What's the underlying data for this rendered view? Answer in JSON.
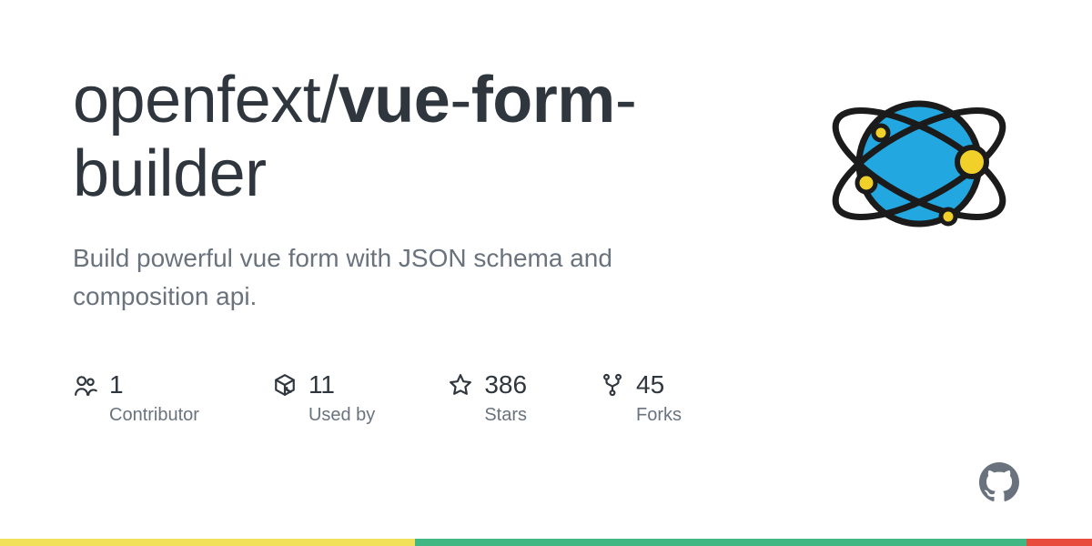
{
  "repo": {
    "owner": "openfext",
    "slash": "/",
    "name_part1": "vue",
    "dash1": "-",
    "name_part2": "form",
    "dash2": "-",
    "name_part3": "builder"
  },
  "description": "Build powerful vue form with JSON schema and composition api.",
  "stats": {
    "contributors": {
      "value": "1",
      "label": "Contributor"
    },
    "used_by": {
      "value": "11",
      "label": "Used by"
    },
    "stars": {
      "value": "386",
      "label": "Stars"
    },
    "forks": {
      "value": "45",
      "label": "Forks"
    }
  },
  "colors": {
    "title": "#2f363d",
    "muted": "#6a737d",
    "bar": [
      {
        "color": "#f1e05a",
        "pct": 38
      },
      {
        "color": "#41b883",
        "pct": 56
      },
      {
        "color": "#e74c3c",
        "pct": 6
      }
    ],
    "logo": {
      "sphere": "#22a7e0",
      "accent": "#f1d02a",
      "stroke": "#1b1b1b"
    }
  }
}
